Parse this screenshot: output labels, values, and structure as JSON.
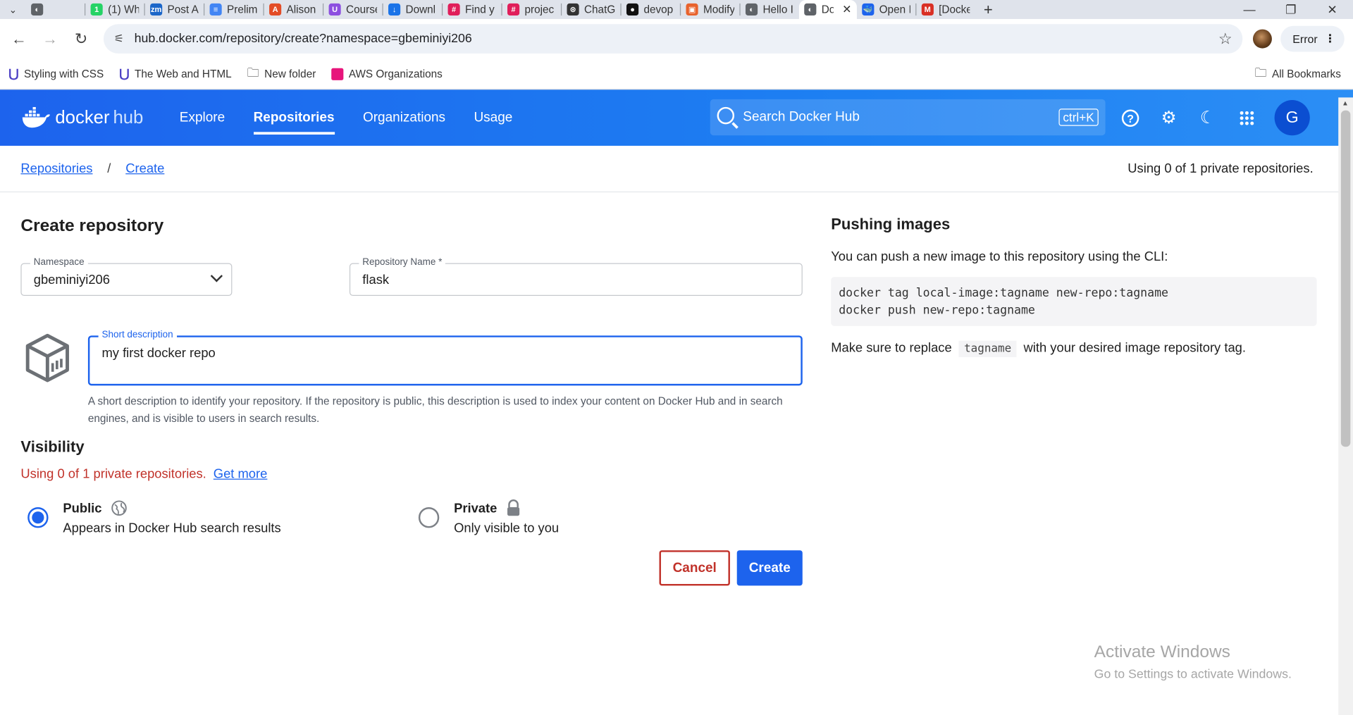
{
  "browser": {
    "tabs": [
      {
        "label": "",
        "color": "#5f6368",
        "glyph": "◐"
      },
      {
        "label": "(1) Wh",
        "color": "#25d366",
        "glyph": "1"
      },
      {
        "label": "Post A",
        "color": "#1b66c9",
        "glyph": "zm"
      },
      {
        "label": "Prelim",
        "color": "#4285f4",
        "glyph": "≡"
      },
      {
        "label": "Alison",
        "color": "#e34c26",
        "glyph": "A"
      },
      {
        "label": "Course",
        "color": "#8c4fe0",
        "glyph": "U"
      },
      {
        "label": "Downl",
        "color": "#1a73e8",
        "glyph": "↓"
      },
      {
        "label": "Find y",
        "color": "#e01e5a",
        "glyph": "#"
      },
      {
        "label": "projec",
        "color": "#e01e5a",
        "glyph": "#"
      },
      {
        "label": "ChatG",
        "color": "#333333",
        "glyph": "⊛"
      },
      {
        "label": "devop",
        "color": "#111111",
        "glyph": "●"
      },
      {
        "label": "Modify",
        "color": "#e8622c",
        "glyph": "▣"
      },
      {
        "label": "Hello I",
        "color": "#5f6368",
        "glyph": "◐"
      },
      {
        "label": "Do",
        "color": "#5f6368",
        "glyph": "◐",
        "active": true
      },
      {
        "label": "Open I",
        "color": "#1d63ed",
        "glyph": "🐳"
      },
      {
        "label": "[Docke",
        "color": "#d93025",
        "glyph": "M"
      }
    ],
    "url": "hub.docker.com/repository/create?namespace=gbeminiyi206",
    "error_label": "Error",
    "bookmarks": [
      {
        "label": "Styling with CSS",
        "icon": "bookmark-u-icon"
      },
      {
        "label": "The Web and HTML",
        "icon": "bookmark-u-icon"
      },
      {
        "label": "New folder",
        "icon": "folder-icon"
      },
      {
        "label": "AWS Organizations",
        "icon": "aws-icon"
      }
    ],
    "all_bookmarks": "All Bookmarks"
  },
  "header": {
    "logo_docker": "docker",
    "logo_hub": "hub",
    "nav": [
      {
        "label": "Explore",
        "active": false
      },
      {
        "label": "Repositories",
        "active": true
      },
      {
        "label": "Organizations",
        "active": false
      },
      {
        "label": "Usage",
        "active": false
      }
    ],
    "search_placeholder": "Search Docker Hub",
    "search_shortcut": "ctrl+K",
    "avatar_initial": "G"
  },
  "breadcrumb": {
    "items": [
      "Repositories",
      "Create"
    ],
    "usage_text": "Using 0 of 1 private repositories."
  },
  "form": {
    "title": "Create repository",
    "namespace_label": "Namespace",
    "namespace_value": "gbeminiyi206",
    "repo_name_label": "Repository Name *",
    "repo_name_value": "flask",
    "short_desc_label": "Short description",
    "short_desc_value": "my first docker repo",
    "helper_text": "A short description to identify your repository. If the repository is public, this description is used to index your content on Docker Hub and in search engines, and is visible to users in search results.",
    "visibility_title": "Visibility",
    "visibility_usage": "Using 0 of 1 private repositories.",
    "get_more": "Get more",
    "public_label": "Public",
    "public_sub": "Appears in Docker Hub search results",
    "private_label": "Private",
    "private_sub": "Only visible to you",
    "selected": "public",
    "cancel": "Cancel",
    "create": "Create"
  },
  "push_panel": {
    "title": "Pushing images",
    "intro": "You can push a new image to this repository using the CLI:",
    "code_line1": "docker tag local-image:tagname new-repo:tagname",
    "code_line2": "docker push new-repo:tagname",
    "note_before": "Make sure to replace",
    "note_code": "tagname",
    "note_after": "with your desired image repository tag."
  },
  "watermark": {
    "line1": "Activate Windows",
    "line2": "Go to Settings to activate Windows."
  },
  "colors": {
    "brand_blue": "#1d63ed",
    "error_red": "#c1322a"
  }
}
